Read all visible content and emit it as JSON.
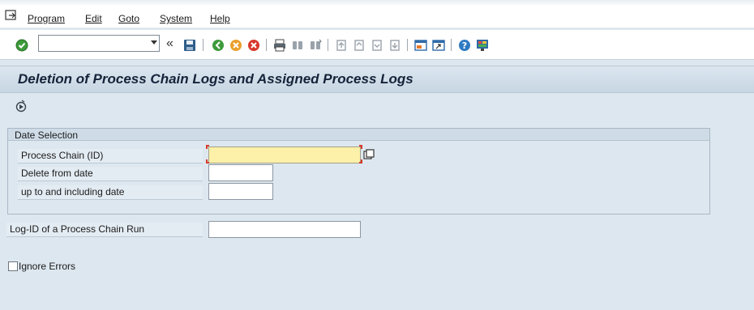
{
  "menu": {
    "items": [
      "Program",
      "Edit",
      "Goto",
      "System",
      "Help"
    ]
  },
  "toolbar": {
    "command_field_value": "",
    "icons": [
      "enter-icon",
      "back-icon",
      "save-icon",
      "green-back-icon",
      "exit-icon",
      "cancel-icon",
      "print-icon",
      "find-icon",
      "find-next-icon",
      "first-page-icon",
      "previous-page-icon",
      "next-page-icon",
      "last-page-icon",
      "create-session-icon",
      "shortcut-icon",
      "help-icon",
      "layout-icon"
    ]
  },
  "page": {
    "title": "Deletion of Process Chain Logs and Assigned Process Logs"
  },
  "app_toolbar": {
    "execute_icon": "execute-icon"
  },
  "date_selection": {
    "title": "Date Selection",
    "fields": [
      {
        "label": "Process Chain (ID)",
        "value": ""
      },
      {
        "label": "Delete from date",
        "value": ""
      },
      {
        "label": "up to and including date",
        "value": ""
      }
    ]
  },
  "log_id": {
    "label": "Log-ID of a Process Chain Run",
    "value": ""
  },
  "ignore_errors": {
    "label": "Ignore Errors",
    "checked": false
  },
  "colors": {
    "background": "#dde7ef",
    "required_field": "#fdf0a8",
    "title_text": "#15233a"
  }
}
